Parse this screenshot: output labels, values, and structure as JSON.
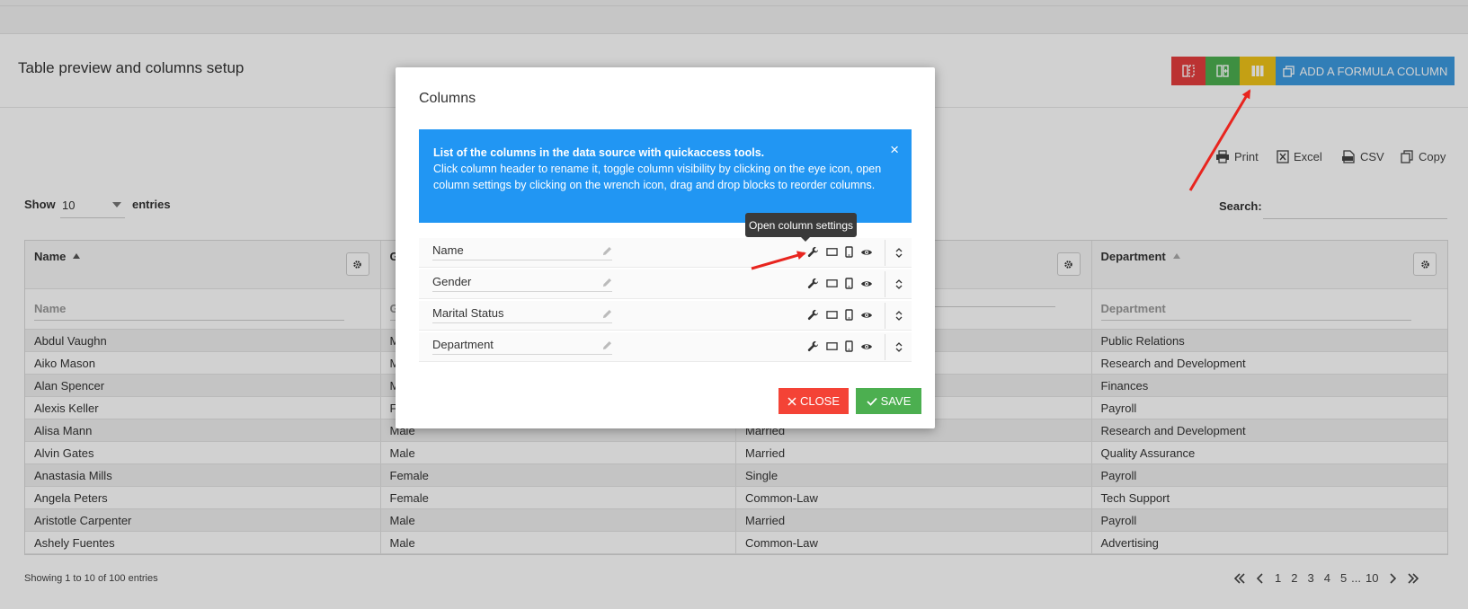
{
  "page": {
    "title": "Table preview and columns setup",
    "toolbar": {
      "add_formula_label": "ADD A FORMULA COLUMN"
    },
    "export_buttons": [
      "Print",
      "Excel",
      "CSV",
      "Copy"
    ],
    "show": {
      "label": "Show",
      "value": "10",
      "suffix": "entries"
    },
    "search": {
      "label": "Search:",
      "value": ""
    },
    "table": {
      "headers": [
        "Name",
        "G",
        "",
        "Department"
      ],
      "filters": [
        "Name",
        "G",
        "",
        "Department"
      ],
      "rows": [
        [
          "Abdul Vaughn",
          "M",
          "",
          "Public Relations"
        ],
        [
          "Aiko Mason",
          "M",
          "",
          "Research and Development"
        ],
        [
          "Alan Spencer",
          "M",
          "",
          "Finances"
        ],
        [
          "Alexis Keller",
          "F",
          "",
          "Payroll"
        ],
        [
          "Alisa Mann",
          "Male",
          "Married",
          "Research and Development"
        ],
        [
          "Alvin Gates",
          "Male",
          "Married",
          "Quality Assurance"
        ],
        [
          "Anastasia Mills",
          "Female",
          "Single",
          "Payroll"
        ],
        [
          "Angela Peters",
          "Female",
          "Common-Law",
          "Tech Support"
        ],
        [
          "Aristotle Carpenter",
          "Male",
          "Married",
          "Payroll"
        ],
        [
          "Ashely Fuentes",
          "Male",
          "Common-Law",
          "Advertising"
        ]
      ]
    },
    "info": "Showing 1 to 10 of 100 entries",
    "pagination": [
      "1",
      "2",
      "3",
      "4",
      "5",
      "...",
      "10"
    ]
  },
  "modal": {
    "title": "Columns",
    "alert": {
      "heading": "List of the columns in the data source with quickaccess tools.",
      "body": "Click column header to rename it, toggle column visibility by clicking on the eye icon, open column settings by clicking on the wrench icon, drag and drop blocks to reorder columns.",
      "close": "×"
    },
    "columns": [
      "Name",
      "Gender",
      "Marital Status",
      "Department"
    ],
    "tooltip": "Open column settings",
    "close_label": "CLOSE",
    "save_label": "SAVE"
  },
  "colors": {
    "red": "#e53e3e",
    "green": "#4caf50",
    "yellow": "#f0c419",
    "blue": "#3c9ae0",
    "alert_blue": "#2196f3",
    "annotation_arrow": "#e8251f"
  }
}
